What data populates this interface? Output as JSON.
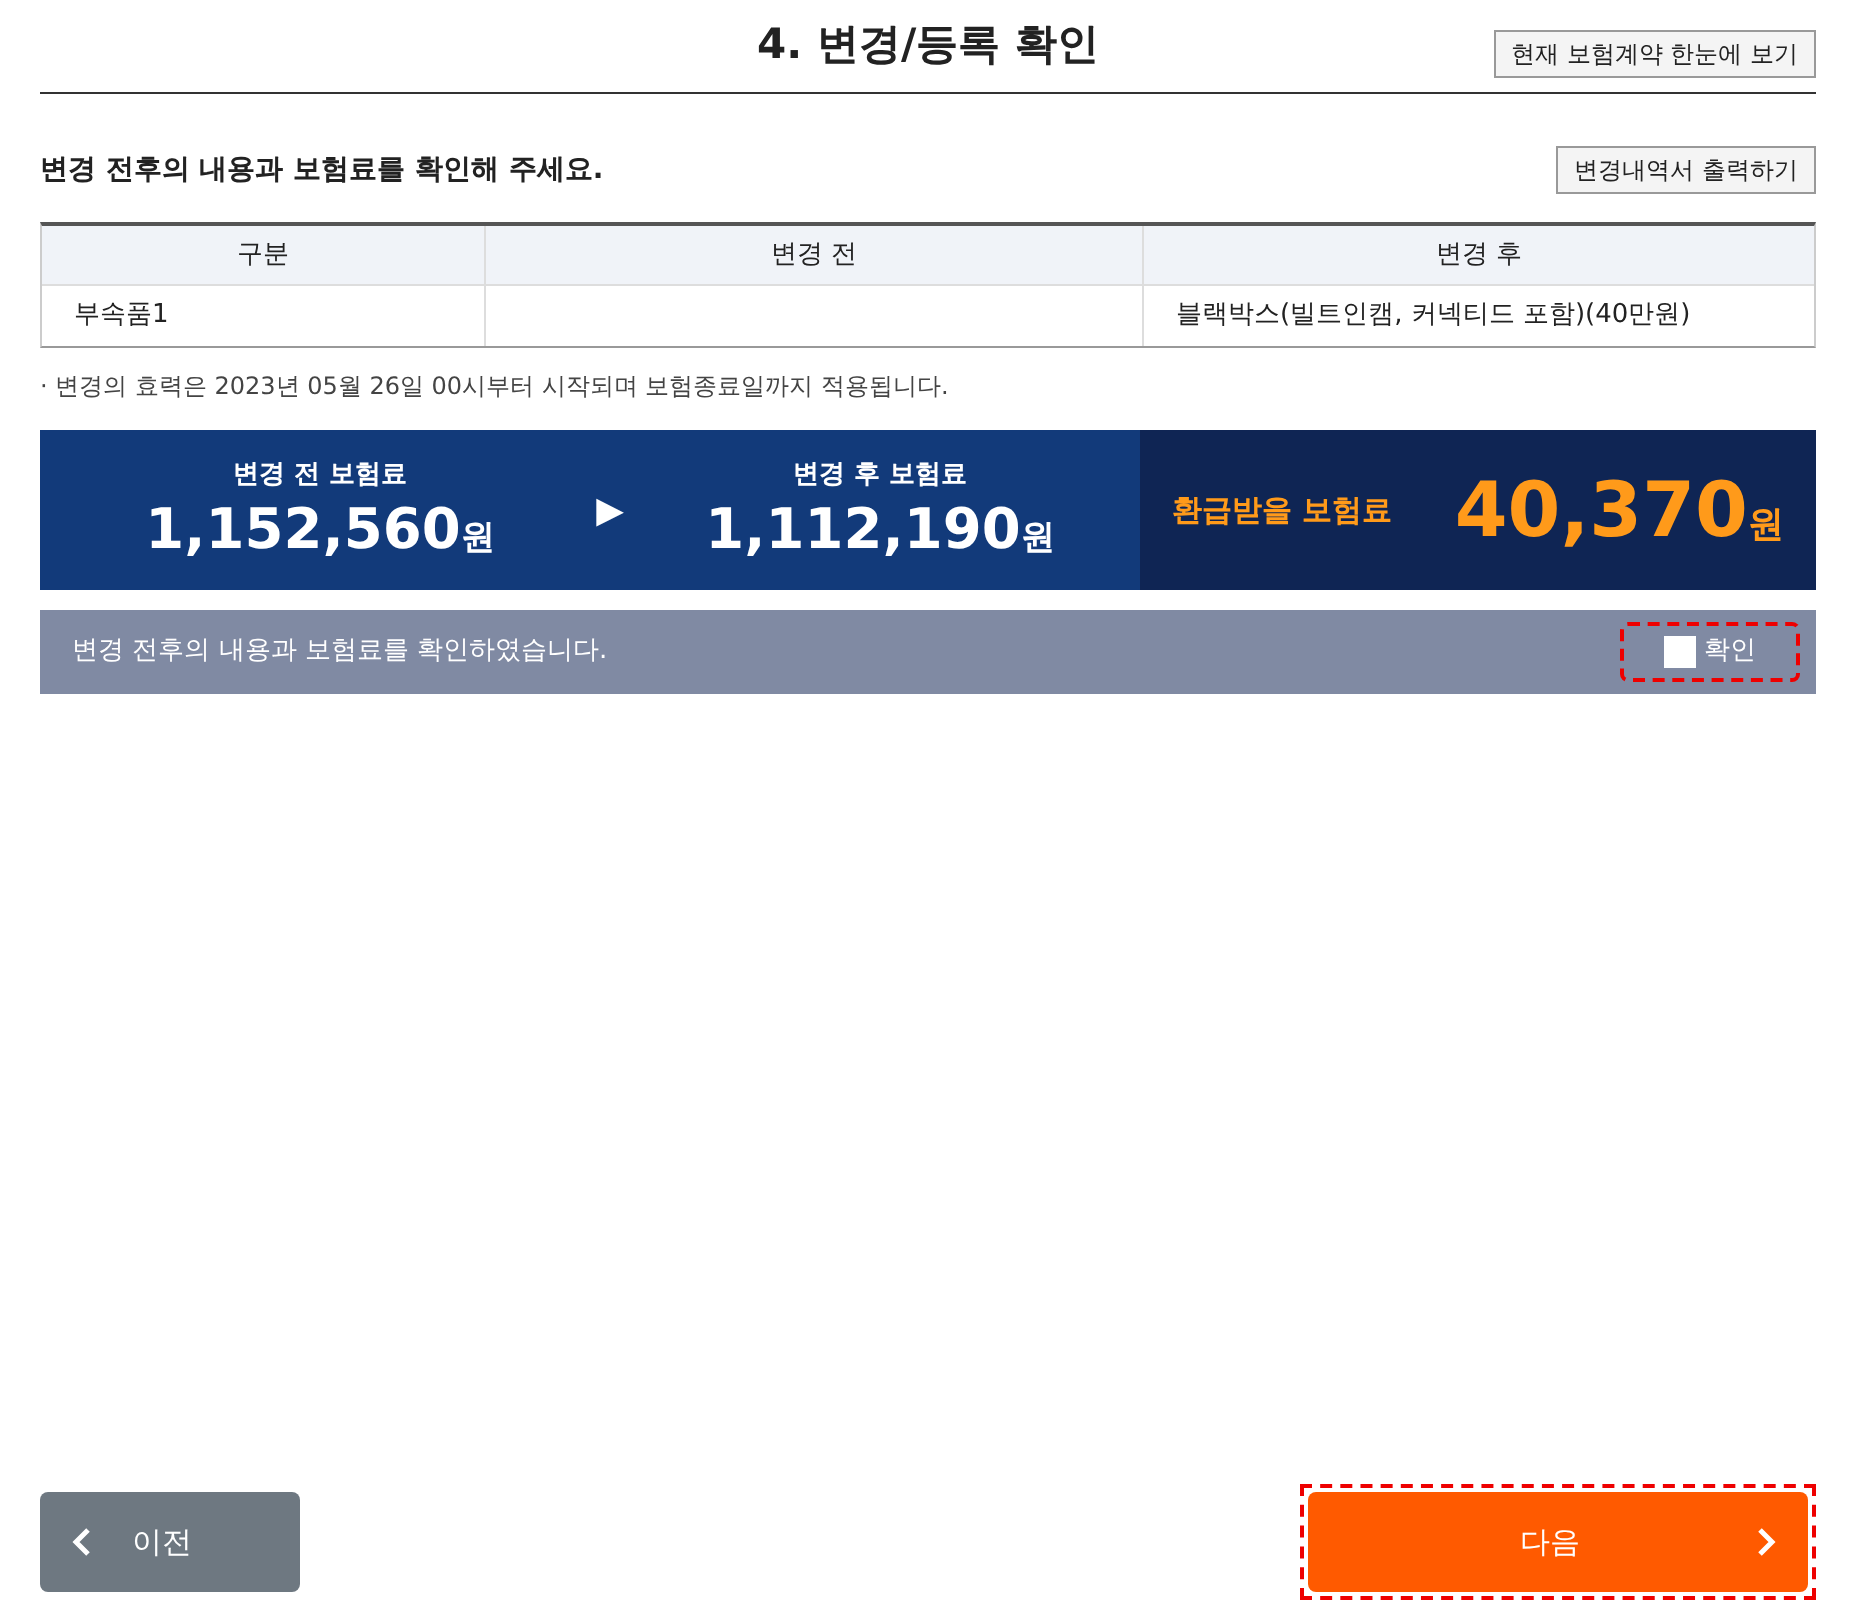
{
  "title": "4. 변경/등록 확인",
  "view_contract_button": "현재 보험계약 한눈에 보기",
  "instruction": "변경 전후의 내용과 보험료를 확인해 주세요.",
  "print_button": "변경내역서 출력하기",
  "table": {
    "columns": [
      "구분",
      "변경 전",
      "변경 후"
    ],
    "rows": [
      [
        "부속품1",
        "",
        "블랙박스(빌트인캠, 커넥티드 포함)(40만원)"
      ]
    ]
  },
  "note": "· 변경의 효력은 2023년 05월 26일 00시부터 시작되며 보험종료일까지 적용됩니다.",
  "summary": {
    "before": {
      "label": "변경 전 보험료",
      "amount": "1,152,560",
      "unit": "원"
    },
    "arrow": "▶",
    "after": {
      "label": "변경 후 보험료",
      "amount": "1,112,190",
      "unit": "원"
    },
    "refund": {
      "label": "환급받을 보험료",
      "amount": "40,370",
      "unit": "원"
    }
  },
  "confirm": {
    "text": "변경 전후의 내용과 보험료를 확인하였습니다.",
    "label": "확인",
    "checked": false
  },
  "prev_button": "이전",
  "next_button": "다음"
}
